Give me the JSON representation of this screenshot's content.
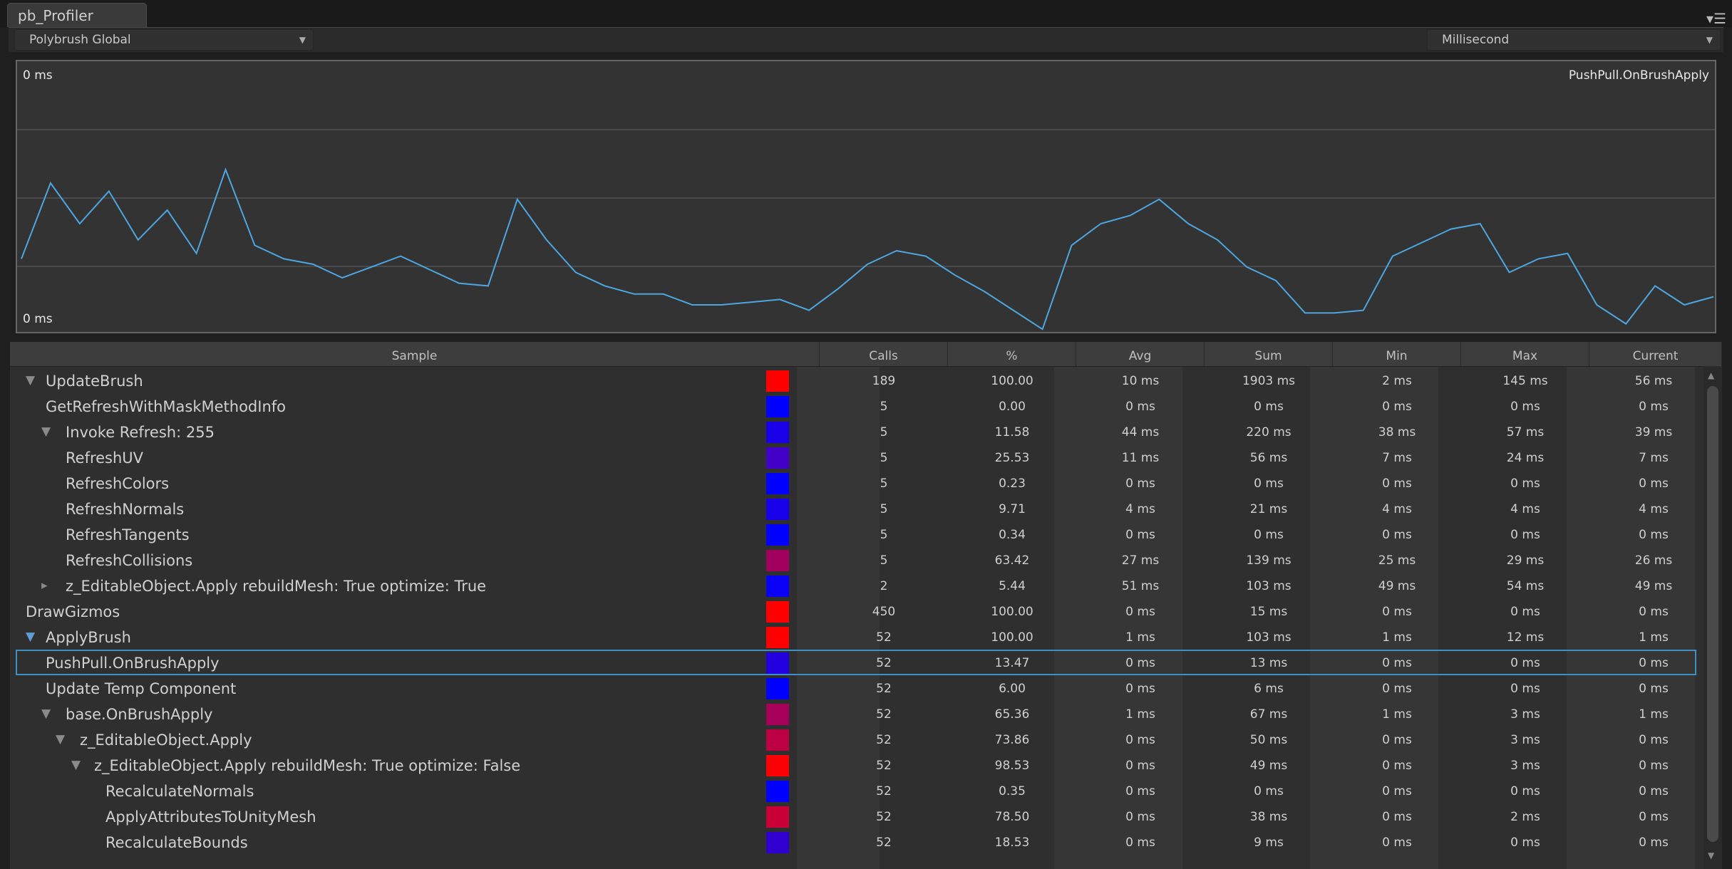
{
  "window": {
    "tab_title": "pb_Profiler",
    "menu_icon": "hamburger-icon"
  },
  "toolbar": {
    "group_select": "Polybrush Global",
    "unit_select": "Millisecond"
  },
  "graph": {
    "top_label": "0 ms",
    "bottom_label": "0 ms",
    "sample_label": "PushPull.OnBrushApply",
    "line_color": "#4da6e0",
    "series": [
      73,
      45,
      60,
      48,
      66,
      55,
      71,
      40,
      68,
      73,
      75,
      80,
      76,
      72,
      77,
      82,
      83,
      51,
      66,
      78,
      83,
      86,
      86,
      90,
      90,
      89,
      88,
      92,
      84,
      75,
      70,
      72,
      79,
      85,
      92,
      99,
      68,
      60,
      57,
      51,
      60,
      66,
      76,
      81,
      93,
      93,
      92,
      72,
      67,
      62,
      60,
      78,
      73,
      71,
      90,
      97,
      83,
      90,
      87
    ]
  },
  "table": {
    "columns": [
      "Sample",
      "Calls",
      "%",
      "Avg",
      "Sum",
      "Min",
      "Max",
      "Current"
    ],
    "selected_index": 11,
    "rows": [
      {
        "name": "UpdateBrush",
        "tri": "down",
        "indent": 0,
        "color": "#ff0000",
        "calls": "189",
        "pct": "100.00",
        "avg": "10 ms",
        "sum": "1903 ms",
        "min": "2 ms",
        "max": "145 ms",
        "current": "56 ms"
      },
      {
        "name": "GetRefreshWithMaskMethodInfo",
        "tri": "",
        "indent": 1,
        "color": "#0000ff",
        "calls": "5",
        "pct": "0.00",
        "avg": "0 ms",
        "sum": "0 ms",
        "min": "0 ms",
        "max": "0 ms",
        "current": "0 ms"
      },
      {
        "name": "Invoke Refresh: 255",
        "tri": "down",
        "indent": 2,
        "color": "#1a00e8",
        "calls": "5",
        "pct": "11.58",
        "avg": "44 ms",
        "sum": "220 ms",
        "min": "38 ms",
        "max": "57 ms",
        "current": "39 ms"
      },
      {
        "name": "RefreshUV",
        "tri": "",
        "indent": 2,
        "color": "#4200c8",
        "calls": "5",
        "pct": "25.53",
        "avg": "11 ms",
        "sum": "56 ms",
        "min": "7 ms",
        "max": "24 ms",
        "current": "7 ms"
      },
      {
        "name": "RefreshColors",
        "tri": "",
        "indent": 2,
        "color": "#0000ff",
        "calls": "5",
        "pct": "0.23",
        "avg": "0 ms",
        "sum": "0 ms",
        "min": "0 ms",
        "max": "0 ms",
        "current": "0 ms"
      },
      {
        "name": "RefreshNormals",
        "tri": "",
        "indent": 2,
        "color": "#1800ea",
        "calls": "5",
        "pct": "9.71",
        "avg": "4 ms",
        "sum": "21 ms",
        "min": "4 ms",
        "max": "4 ms",
        "current": "4 ms"
      },
      {
        "name": "RefreshTangents",
        "tri": "",
        "indent": 2,
        "color": "#0000ff",
        "calls": "5",
        "pct": "0.34",
        "avg": "0 ms",
        "sum": "0 ms",
        "min": "0 ms",
        "max": "0 ms",
        "current": "0 ms"
      },
      {
        "name": "RefreshCollisions",
        "tri": "",
        "indent": 2,
        "color": "#a2005e",
        "calls": "5",
        "pct": "63.42",
        "avg": "27 ms",
        "sum": "139 ms",
        "min": "25 ms",
        "max": "29 ms",
        "current": "26 ms"
      },
      {
        "name": "z_EditableObject.Apply rebuildMesh: True optimize: True",
        "tri": "right",
        "indent": 2,
        "color": "#0a00f5",
        "calls": "2",
        "pct": "5.44",
        "avg": "51 ms",
        "sum": "103 ms",
        "min": "49 ms",
        "max": "54 ms",
        "current": "49 ms"
      },
      {
        "name": "DrawGizmos",
        "tri": "",
        "indent": -1,
        "color": "#ff0000",
        "calls": "450",
        "pct": "100.00",
        "avg": "0 ms",
        "sum": "15 ms",
        "min": "0 ms",
        "max": "0 ms",
        "current": "0 ms"
      },
      {
        "name": "ApplyBrush",
        "tri": "down-blue",
        "indent": 0,
        "color": "#ff0000",
        "calls": "52",
        "pct": "100.00",
        "avg": "1 ms",
        "sum": "103 ms",
        "min": "1 ms",
        "max": "12 ms",
        "current": "1 ms"
      },
      {
        "name": "PushPull.OnBrushApply",
        "tri": "",
        "indent": 1,
        "color": "#2200e0",
        "calls": "52",
        "pct": "13.47",
        "avg": "0 ms",
        "sum": "13 ms",
        "min": "0 ms",
        "max": "0 ms",
        "current": "0 ms"
      },
      {
        "name": "Update Temp Component",
        "tri": "",
        "indent": 1,
        "color": "#0000ff",
        "calls": "52",
        "pct": "6.00",
        "avg": "0 ms",
        "sum": "6 ms",
        "min": "0 ms",
        "max": "0 ms",
        "current": "0 ms"
      },
      {
        "name": "base.OnBrushApply",
        "tri": "down",
        "indent": 2,
        "color": "#a6005a",
        "calls": "52",
        "pct": "65.36",
        "avg": "1 ms",
        "sum": "67 ms",
        "min": "1 ms",
        "max": "3 ms",
        "current": "1 ms"
      },
      {
        "name": "z_EditableObject.Apply",
        "tri": "down",
        "indent": 3,
        "color": "#bc0043",
        "calls": "52",
        "pct": "73.86",
        "avg": "0 ms",
        "sum": "50 ms",
        "min": "0 ms",
        "max": "3 ms",
        "current": "0 ms"
      },
      {
        "name": "z_EditableObject.Apply rebuildMesh: True optimize: False",
        "tri": "down",
        "indent": 4,
        "color": "#fb0004",
        "calls": "52",
        "pct": "98.53",
        "avg": "0 ms",
        "sum": "49 ms",
        "min": "0 ms",
        "max": "3 ms",
        "current": "0 ms"
      },
      {
        "name": "RecalculateNormals",
        "tri": "",
        "indent": 5,
        "color": "#0000ff",
        "calls": "52",
        "pct": "0.35",
        "avg": "0 ms",
        "sum": "0 ms",
        "min": "0 ms",
        "max": "0 ms",
        "current": "0 ms"
      },
      {
        "name": "ApplyAttributesToUnityMesh",
        "tri": "",
        "indent": 5,
        "color": "#c80037",
        "calls": "52",
        "pct": "78.50",
        "avg": "0 ms",
        "sum": "38 ms",
        "min": "0 ms",
        "max": "2 ms",
        "current": "0 ms"
      },
      {
        "name": "RecalculateBounds",
        "tri": "",
        "indent": 5,
        "color": "#2f00d0",
        "calls": "52",
        "pct": "18.53",
        "avg": "0 ms",
        "sum": "9 ms",
        "min": "0 ms",
        "max": "0 ms",
        "current": "0 ms"
      }
    ]
  }
}
